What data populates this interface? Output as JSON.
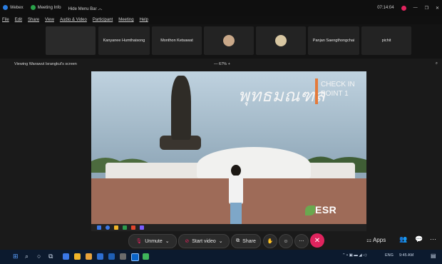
{
  "window": {
    "app_name": "Webex",
    "meeting_info": "Meeting Info",
    "hide_menu_bar": "Hide Menu Bar",
    "clock": "07:14:04"
  },
  "menu": [
    "File",
    "Edit",
    "Share",
    "View",
    "Audio & Video",
    "Participant",
    "Meeting",
    "Help"
  ],
  "participants": [
    {
      "name": ""
    },
    {
      "name": "Kanyanee Humthaisong"
    },
    {
      "name": "Monthon Ketsawat"
    },
    {
      "name": ""
    },
    {
      "name": ""
    },
    {
      "name": "Panjan Saengthongchai"
    },
    {
      "name": "pichit"
    }
  ],
  "viewing": {
    "label": "Viewing Warawut Israngkul's screen",
    "zoom": "67%"
  },
  "shared_screen": {
    "thai_title": "พุทธมณฑล",
    "check_line1": "CHECK IN",
    "check_line2": "POINT 1",
    "logo_text": "ESR"
  },
  "controls": {
    "unmute": "Unmute",
    "start_video": "Start video",
    "share": "Share",
    "apps": "Apps"
  },
  "taskbar": {
    "lang": "ENG",
    "time": "9:45 AM"
  },
  "colors": {
    "leave": "#e0245e",
    "accent": "#e47a3a"
  }
}
